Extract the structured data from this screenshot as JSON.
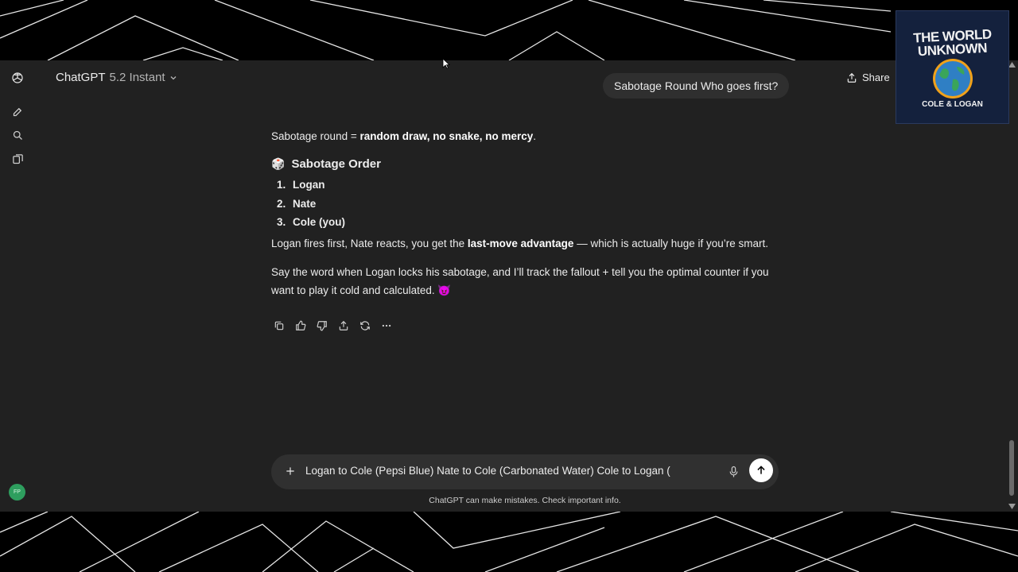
{
  "header": {
    "model_name": "ChatGPT",
    "model_version": "5.2 Instant",
    "conversation_title": "Sabotage Round Who goes first?",
    "share_label": "Share"
  },
  "sidebar": {
    "icons": [
      "new-chat-icon",
      "search-icon",
      "library-icon"
    ],
    "avatar_initials": "FP"
  },
  "message": {
    "intro_prefix": "Sabotage round = ",
    "intro_bold": "random draw, no snake, no mercy",
    "intro_suffix": ".",
    "heading_emoji": "🎲",
    "heading": "Sabotage Order",
    "order": [
      {
        "num": "1.",
        "name": "Logan"
      },
      {
        "num": "2.",
        "name": "Nate"
      },
      {
        "num": "3.",
        "name": "Cole (you)"
      }
    ],
    "para1_prefix": "Logan fires first, Nate reacts, you get the ",
    "para1_bold": "last-move advantage",
    "para1_suffix": " — which is actually huge if you’re smart.",
    "para2_line1": "Say the word when Logan locks his sabotage, and I’ll track the fallout + tell you the optimal counter if you",
    "para2_line2": "want to play it cold and calculated. ",
    "para2_emoji": "😈"
  },
  "actions": [
    "copy-icon",
    "thumbs-up-icon",
    "thumbs-down-icon",
    "share-icon",
    "regenerate-icon",
    "more-icon"
  ],
  "composer": {
    "input_value": "Logan to Cole (Pepsi Blue) Nate to Cole (Carbonated Water) Cole to Logan (",
    "disclaimer": "ChatGPT can make mistakes. Check important info."
  },
  "overlay_logo": {
    "line1": "THE WORLD",
    "line2": "UNKNOWN",
    "line3": "COLE & LOGAN"
  },
  "colors": {
    "background": "#212121",
    "surface": "#303030",
    "text": "#ececec",
    "avatar": "#2e9e5e"
  }
}
